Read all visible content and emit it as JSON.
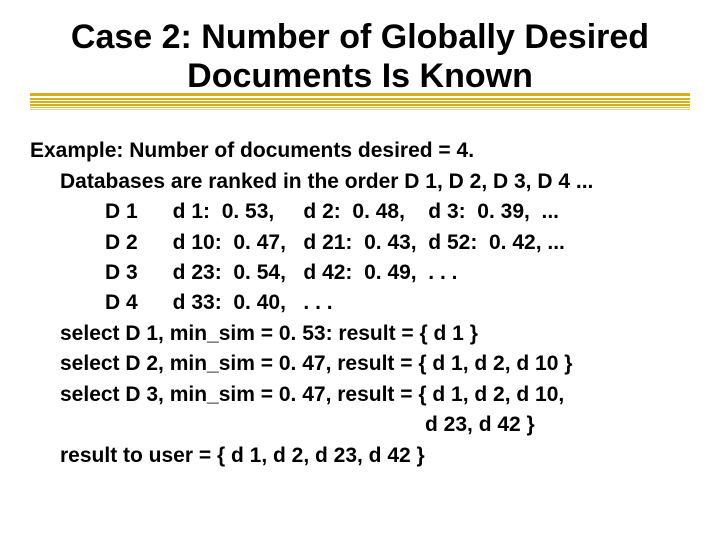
{
  "title_line1": "Case 2: Number of Globally Desired",
  "title_line2": "Documents Is Known",
  "example_line": "Example: Number of documents desired = 4.",
  "ranked_line": "Databases are ranked in the order D 1, D 2, D 3, D 4 ...",
  "rows": {
    "d1": "D 1      d 1:  0. 53,     d 2:  0. 48,    d 3:  0. 39,  ...",
    "d2": "D 2      d 10:  0. 47,   d 21:  0. 43,  d 52:  0. 42, ...",
    "d3": "D 3      d 23:  0. 54,   d 42:  0. 49,  . . .",
    "d4": "D 4      d 33:  0. 40,   . . ."
  },
  "selects": {
    "s1": "select D 1, min_sim = 0. 53: result = { d 1 }",
    "s2": "select D 2, min_sim = 0. 47, result = { d 1, d 2, d 10 }",
    "s3": "select D 3, min_sim = 0. 47, result = { d 1, d 2, d 10,",
    "s3b": "d 23, d 42 }"
  },
  "result_line": "result to user = { d 1, d 2, d 23, d 42 }",
  "chart_data": {
    "type": "table",
    "title": "Ranked database documents with similarity scores",
    "databases": [
      {
        "name": "D1",
        "docs": [
          {
            "id": "d1",
            "sim": 0.53
          },
          {
            "id": "d2",
            "sim": 0.48
          },
          {
            "id": "d3",
            "sim": 0.39
          }
        ]
      },
      {
        "name": "D2",
        "docs": [
          {
            "id": "d10",
            "sim": 0.47
          },
          {
            "id": "d21",
            "sim": 0.43
          },
          {
            "id": "d52",
            "sim": 0.42
          }
        ]
      },
      {
        "name": "D3",
        "docs": [
          {
            "id": "d23",
            "sim": 0.54
          },
          {
            "id": "d42",
            "sim": 0.49
          }
        ]
      },
      {
        "name": "D4",
        "docs": [
          {
            "id": "d33",
            "sim": 0.4
          }
        ]
      }
    ],
    "desired_documents": 4,
    "selections": [
      {
        "db": "D1",
        "min_sim": 0.53,
        "result": [
          "d1"
        ]
      },
      {
        "db": "D2",
        "min_sim": 0.47,
        "result": [
          "d1",
          "d2",
          "d10"
        ]
      },
      {
        "db": "D3",
        "min_sim": 0.47,
        "result": [
          "d1",
          "d2",
          "d10",
          "d23",
          "d42"
        ]
      }
    ],
    "final_result": [
      "d1",
      "d2",
      "d23",
      "d42"
    ]
  }
}
